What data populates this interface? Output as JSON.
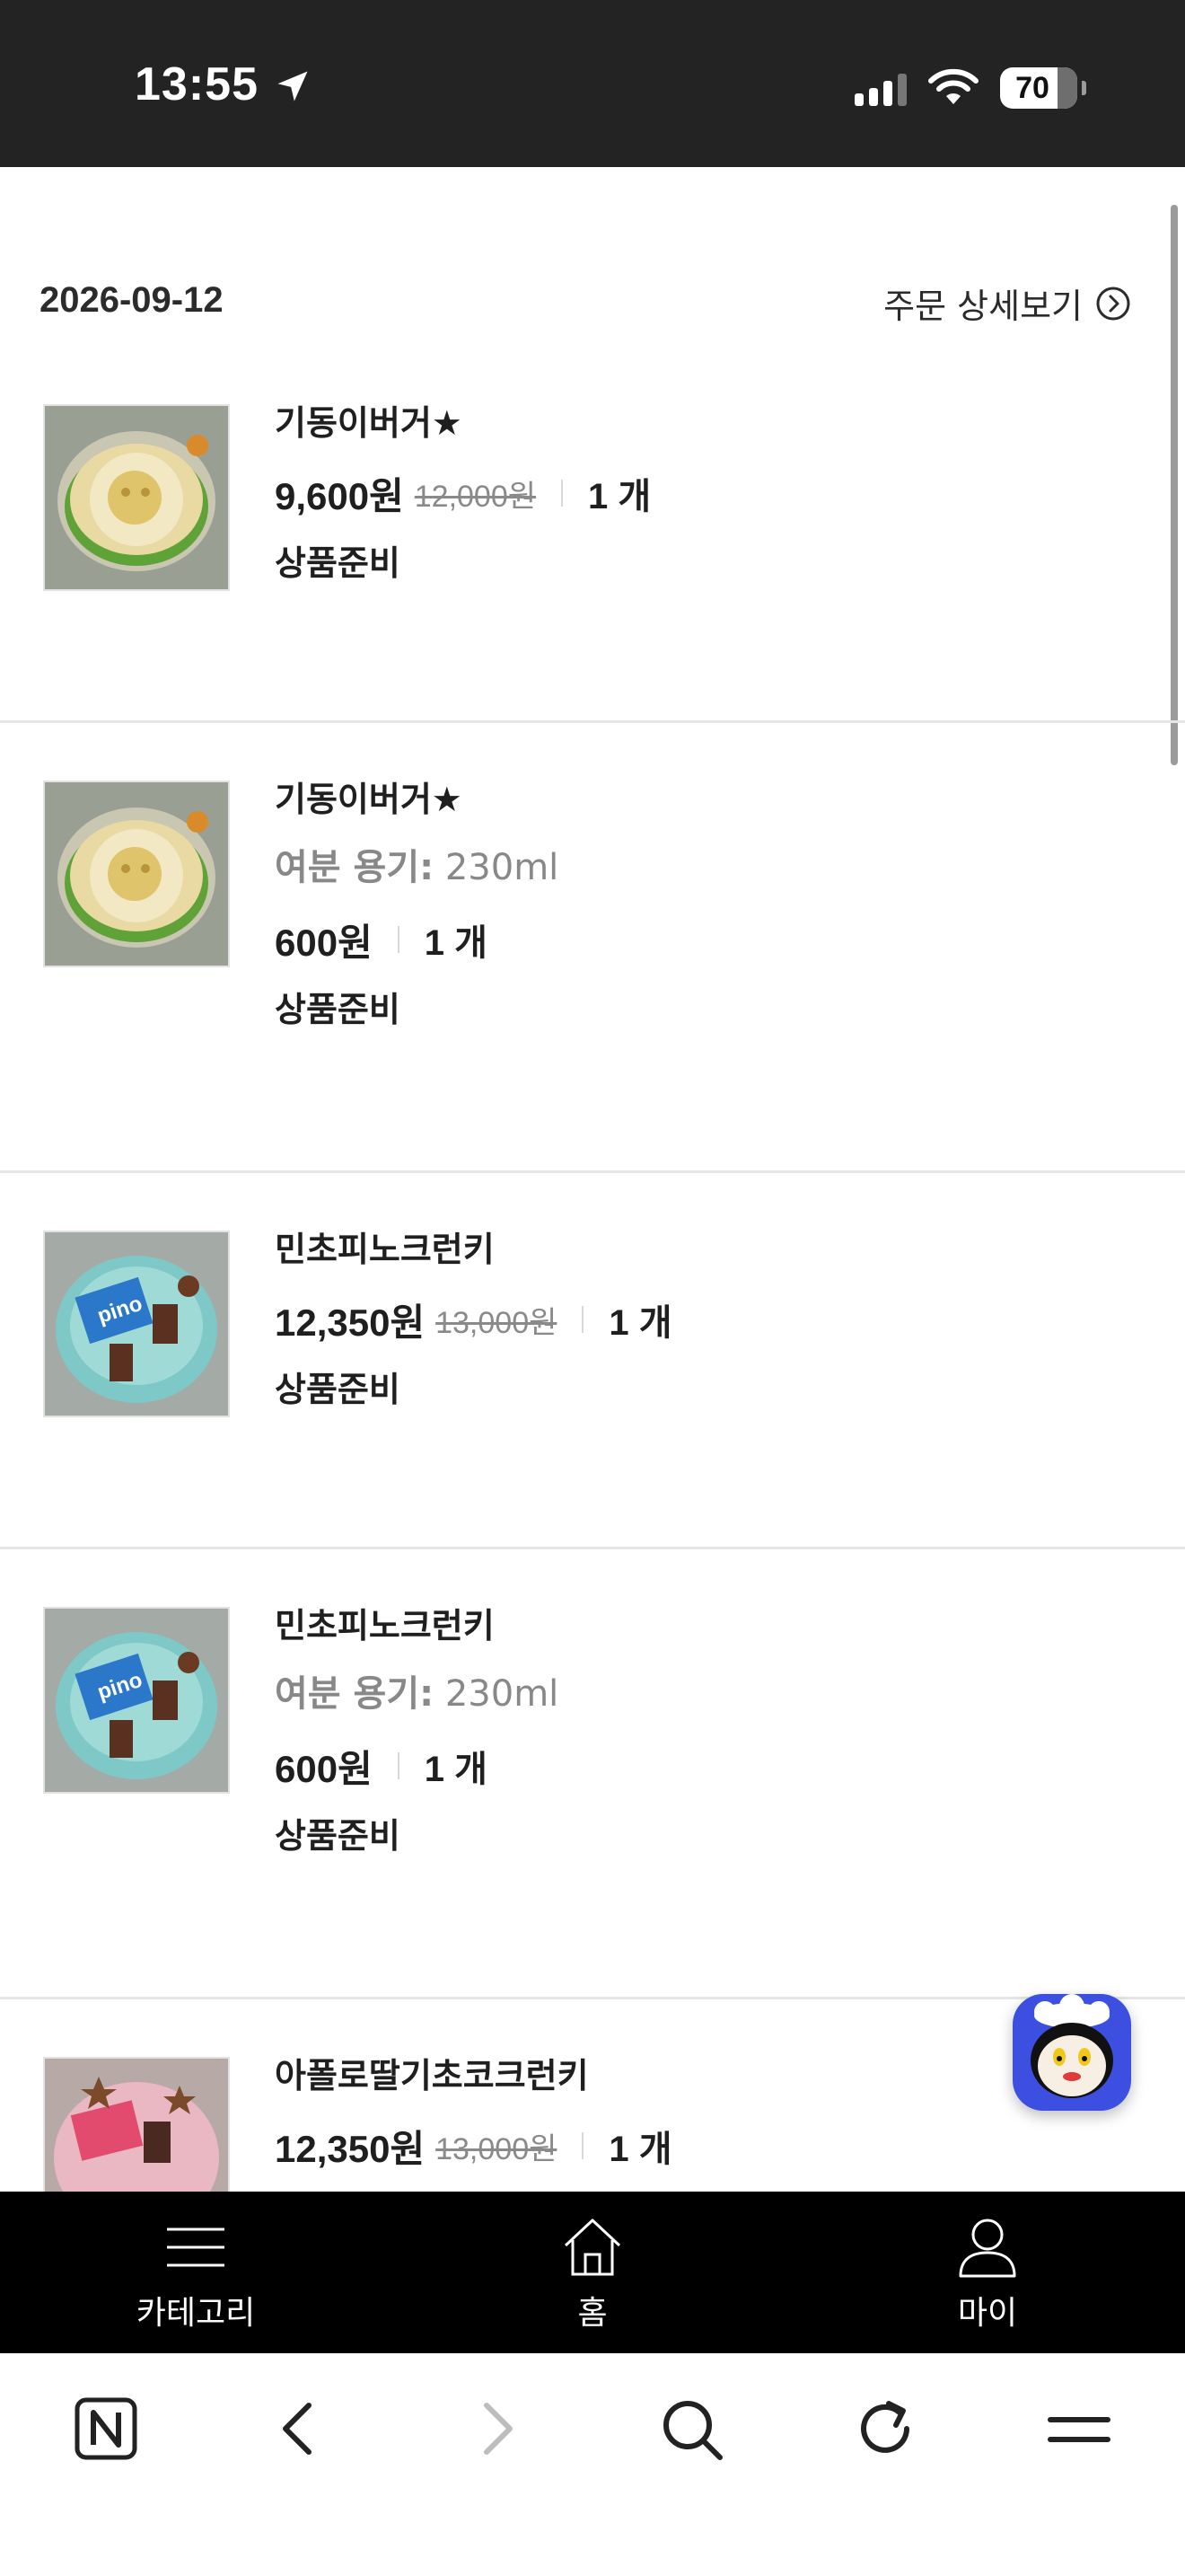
{
  "status_bar": {
    "time": "13:55",
    "battery": "70",
    "icons": [
      "location-arrow-icon",
      "cellular-signal-icon",
      "wifi-icon",
      "battery-icon"
    ]
  },
  "order": {
    "date": "2026-09-12",
    "detail_label": "주문 상세보기"
  },
  "items": [
    {
      "name": "기동이버거★",
      "price": "9,600원",
      "original_price": "12,000원",
      "quantity": "1 개",
      "status": "상품준비",
      "option_label": "",
      "option_value": ""
    },
    {
      "name": "기동이버거★",
      "price": "600원",
      "original_price": "",
      "quantity": "1 개",
      "status": "상품준비",
      "option_label": "여분 용기:",
      "option_value": "230ml"
    },
    {
      "name": "민초피노크런키",
      "price": "12,350원",
      "original_price": "13,000원",
      "quantity": "1 개",
      "status": "상품준비",
      "option_label": "",
      "option_value": ""
    },
    {
      "name": "민초피노크런키",
      "price": "600원",
      "original_price": "",
      "quantity": "1 개",
      "status": "상품준비",
      "option_label": "여분 용기:",
      "option_value": "230ml"
    },
    {
      "name": "아폴로딸기초코크런키",
      "price": "12,350원",
      "original_price": "13,000원",
      "quantity": "1 개",
      "status": "",
      "option_label": "",
      "option_value": ""
    }
  ],
  "app_nav": {
    "category": "카테고리",
    "home": "홈",
    "my": "마이"
  },
  "browser_toolbar": {
    "icons": [
      "naver-icon",
      "back-icon",
      "forward-icon",
      "search-icon",
      "reload-icon",
      "menu-icon"
    ]
  }
}
